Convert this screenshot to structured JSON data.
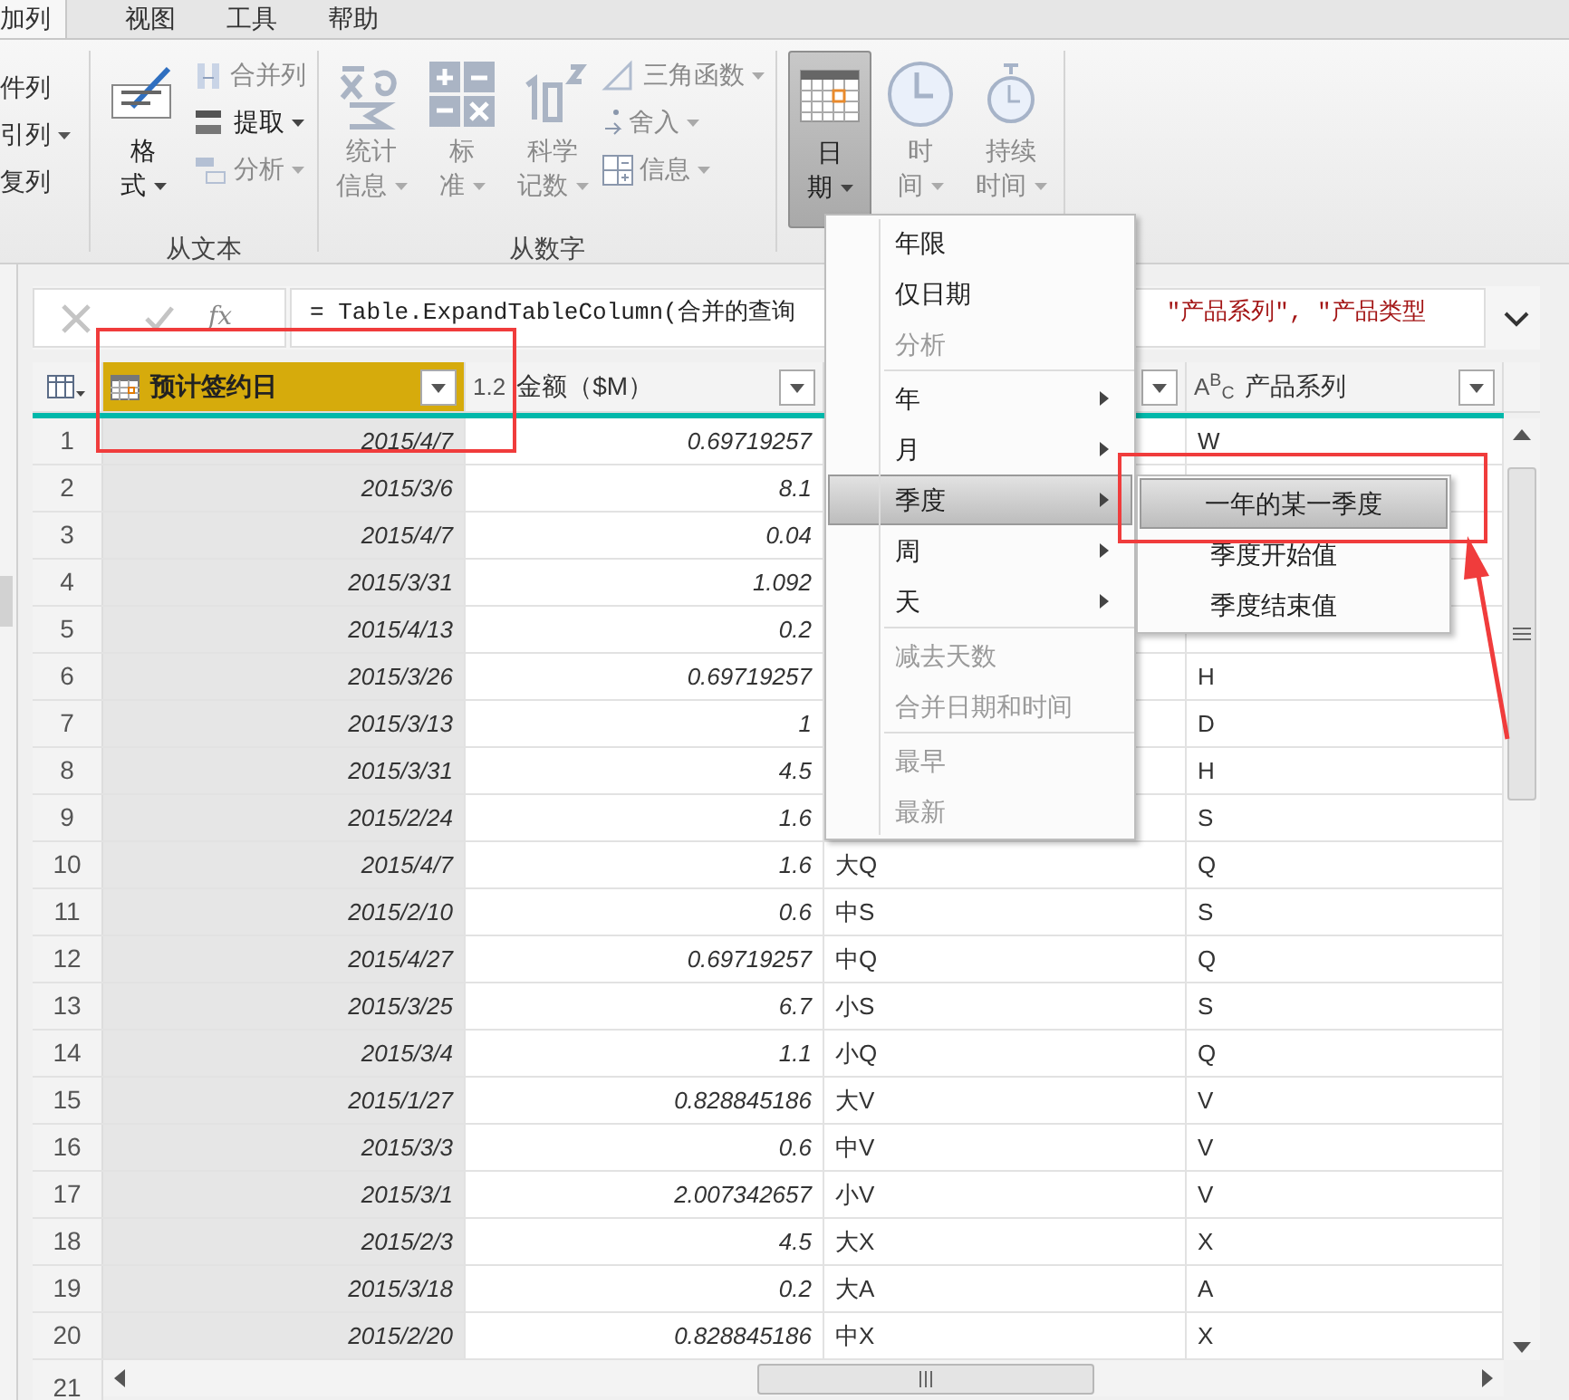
{
  "tabs": [
    {
      "label": "加列",
      "selected": true
    },
    {
      "label": "视图",
      "selected": false
    },
    {
      "label": "工具",
      "selected": false
    },
    {
      "label": "帮助",
      "selected": false
    }
  ],
  "ribbon": {
    "cut_group": [
      {
        "label": "件列",
        "dropdown": false
      },
      {
        "label": "引列",
        "dropdown": true
      },
      {
        "label": "复列",
        "dropdown": false
      }
    ],
    "groups": [
      {
        "label": "从文本",
        "items": [
          {
            "kind": "large",
            "lines": [
              "格",
              "式"
            ],
            "disabled": false,
            "pressed": false
          },
          {
            "kind": "small-stack",
            "entries": [
              {
                "label": "合并列",
                "dropdown": false,
                "disabled": true
              },
              {
                "label": "提取",
                "dropdown": true,
                "disabled": false
              },
              {
                "label": "分析",
                "dropdown": true,
                "disabled": true
              }
            ]
          }
        ]
      },
      {
        "label": "从数字",
        "items": [
          {
            "kind": "large",
            "lines": [
              "统计",
              "信息"
            ],
            "disabled": true,
            "pressed": false
          },
          {
            "kind": "large",
            "lines": [
              "标",
              "准"
            ],
            "disabled": true,
            "pressed": false
          },
          {
            "kind": "large",
            "lines": [
              "科学",
              "记数"
            ],
            "disabled": true,
            "pressed": false
          },
          {
            "kind": "small-stack",
            "entries": [
              {
                "label": "三角函数",
                "dropdown": true,
                "disabled": true
              },
              {
                "label": "舍入",
                "dropdown": true,
                "disabled": true
              },
              {
                "label": "信息",
                "dropdown": true,
                "disabled": true
              }
            ]
          }
        ]
      },
      {
        "items": [
          {
            "kind": "large",
            "lines": [
              "日",
              "期"
            ],
            "disabled": false,
            "pressed": true
          },
          {
            "kind": "large",
            "lines": [
              "时",
              "间"
            ],
            "disabled": true,
            "pressed": false
          },
          {
            "kind": "large",
            "lines": [
              "持续",
              "时间"
            ],
            "disabled": true,
            "pressed": false
          }
        ]
      }
    ]
  },
  "formula_bar": {
    "fx": "fx",
    "formula_start": "= Table.ExpandTableColumn(合并的查询",
    "formula_end": "\"产品系列\", \"产品类型"
  },
  "table": {
    "columns": [
      {
        "kind": "date",
        "name": "预计签约日",
        "selected": true
      },
      {
        "kind": "typed",
        "name": "金额（$M）",
        "type_label": "1.2",
        "selected": false
      },
      {
        "kind": "covered",
        "selected": false
      },
      {
        "kind": "typed",
        "name": "产品系列",
        "type_label": "A$^{B}$$_{C}$",
        "selected": false
      }
    ],
    "rows": [
      {
        "n": "1",
        "date": "2015/4/7",
        "amount": "0.69719257",
        "series": "W"
      },
      {
        "n": "2",
        "date": "2015/3/6",
        "amount": "8.1"
      },
      {
        "n": "3",
        "date": "2015/4/7",
        "amount": "0.04"
      },
      {
        "n": "4",
        "date": "2015/3/31",
        "amount": "1.092"
      },
      {
        "n": "5",
        "date": "2015/4/13",
        "amount": "0.2"
      },
      {
        "n": "6",
        "date": "2015/3/26",
        "amount": "0.69719257",
        "series": "H"
      },
      {
        "n": "7",
        "date": "2015/3/13",
        "amount": "1",
        "series": "D"
      },
      {
        "n": "8",
        "date": "2015/3/31",
        "amount": "4.5",
        "series": "H"
      },
      {
        "n": "9",
        "date": "2015/2/24",
        "amount": "1.6",
        "series": "S"
      },
      {
        "n": "10",
        "date": "2015/4/7",
        "amount": "1.6",
        "type": "大Q",
        "series": "Q"
      },
      {
        "n": "11",
        "date": "2015/2/10",
        "amount": "0.6",
        "type": "中S",
        "series": "S"
      },
      {
        "n": "12",
        "date": "2015/4/27",
        "amount": "0.69719257",
        "type": "中Q",
        "series": "Q"
      },
      {
        "n": "13",
        "date": "2015/3/25",
        "amount": "6.7",
        "type": "小S",
        "series": "S"
      },
      {
        "n": "14",
        "date": "2015/3/4",
        "amount": "1.1",
        "type": "小Q",
        "series": "Q"
      },
      {
        "n": "15",
        "date": "2015/1/27",
        "amount": "0.828845186",
        "type": "大V",
        "series": "V"
      },
      {
        "n": "16",
        "date": "2015/3/3",
        "amount": "0.6",
        "type": "中V",
        "series": "V"
      },
      {
        "n": "17",
        "date": "2015/3/1",
        "amount": "2.007342657",
        "type": "小V",
        "series": "V"
      },
      {
        "n": "18",
        "date": "2015/2/3",
        "amount": "4.5",
        "type": "大X",
        "series": "X"
      },
      {
        "n": "19",
        "date": "2015/3/18",
        "amount": "0.2",
        "type": "大A",
        "series": "A"
      },
      {
        "n": "20",
        "date": "2015/2/20",
        "amount": "0.828845186",
        "type": "中X",
        "series": "X"
      }
    ],
    "next_row": "21"
  },
  "date_menu": [
    {
      "kind": "item",
      "label": "年限",
      "disabled": false,
      "selected": false,
      "submenu": false
    },
    {
      "kind": "item",
      "label": "仅日期",
      "disabled": false,
      "selected": false,
      "submenu": false
    },
    {
      "kind": "item",
      "label": "分析",
      "disabled": true,
      "selected": false,
      "submenu": false
    },
    {
      "kind": "separator"
    },
    {
      "kind": "item",
      "label": "年",
      "disabled": false,
      "selected": false,
      "submenu": true
    },
    {
      "kind": "item",
      "label": "月",
      "disabled": false,
      "selected": false,
      "submenu": true
    },
    {
      "kind": "item",
      "label": "季度",
      "disabled": false,
      "selected": true,
      "submenu": true
    },
    {
      "kind": "item",
      "label": "周",
      "disabled": false,
      "selected": false,
      "submenu": true
    },
    {
      "kind": "item",
      "label": "天",
      "disabled": false,
      "selected": false,
      "submenu": true
    },
    {
      "kind": "separator"
    },
    {
      "kind": "item",
      "label": "减去天数",
      "disabled": true,
      "selected": false,
      "submenu": false
    },
    {
      "kind": "item",
      "label": "合并日期和时间",
      "disabled": true,
      "selected": false,
      "submenu": false
    },
    {
      "kind": "separator"
    },
    {
      "kind": "item",
      "label": "最早",
      "disabled": true,
      "selected": false,
      "submenu": false
    },
    {
      "kind": "item",
      "label": "最新",
      "disabled": true,
      "selected": false,
      "submenu": false
    }
  ],
  "quarter_submenu": [
    {
      "label": "一年的某一季度",
      "selected": true
    },
    {
      "label": "季度开始值",
      "selected": false
    },
    {
      "label": "季度结束值",
      "selected": false
    }
  ]
}
